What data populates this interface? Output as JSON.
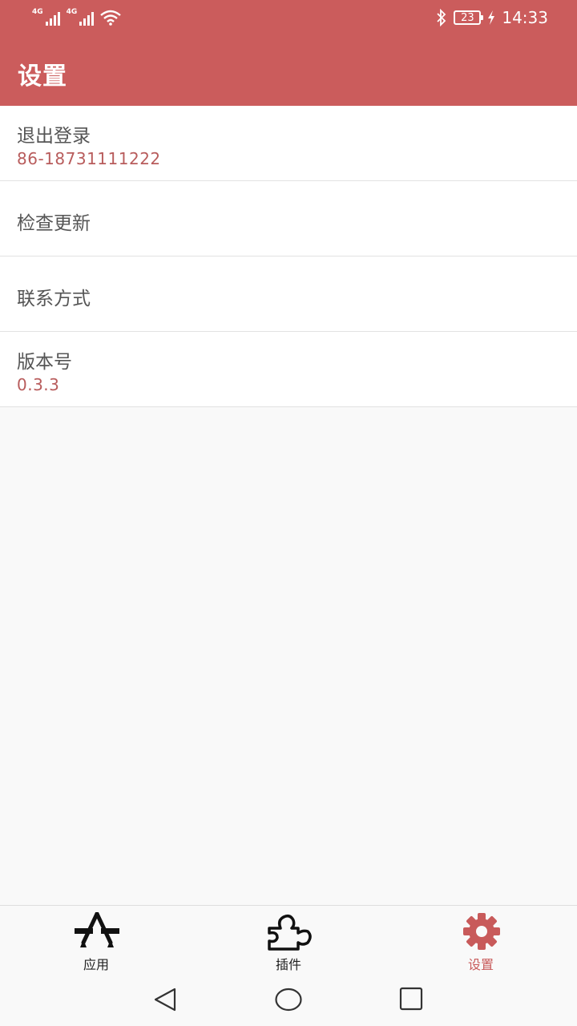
{
  "status_bar": {
    "network1": "4G",
    "network2": "4G",
    "battery_level": "23",
    "time": "14:33"
  },
  "header": {
    "title": "设置"
  },
  "settings": {
    "items": [
      {
        "title": "退出登录",
        "subtitle": "86-18731111222"
      },
      {
        "title": "检查更新"
      },
      {
        "title": "联系方式"
      },
      {
        "title": "版本号",
        "subtitle": "0.3.3"
      }
    ]
  },
  "bottom_nav": {
    "tabs": [
      {
        "label": "应用",
        "icon": "apps-icon"
      },
      {
        "label": "插件",
        "icon": "puzzle-icon"
      },
      {
        "label": "设置",
        "icon": "gear-icon",
        "active": true
      }
    ]
  },
  "colors": {
    "accent": "#cb5c5c",
    "subtitle": "#b85c5c",
    "background": "#f9f9f9"
  }
}
